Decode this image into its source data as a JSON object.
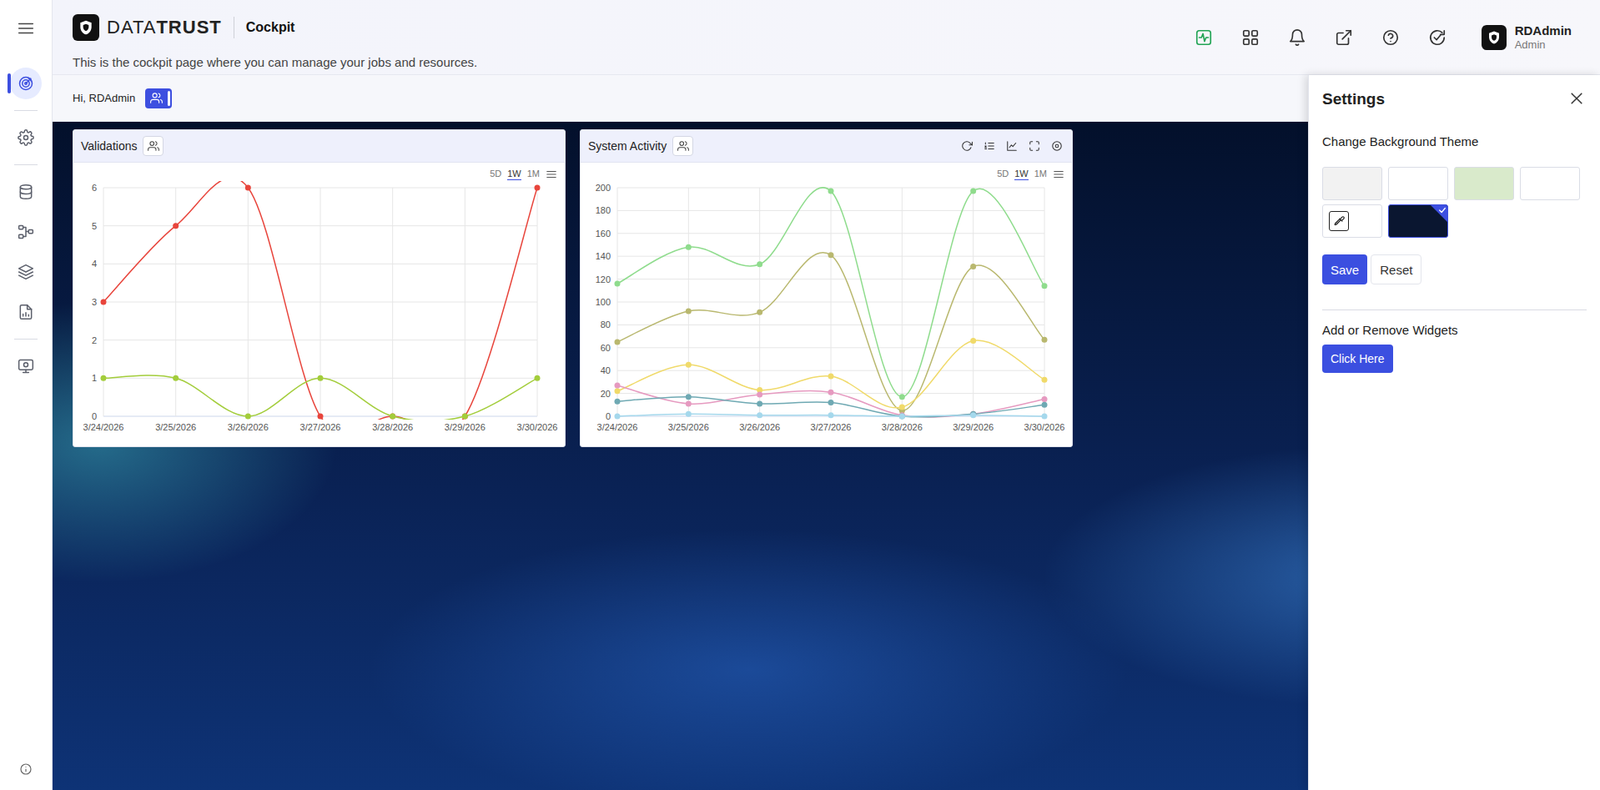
{
  "sidebar": {
    "items": [
      {
        "selected": true
      },
      {
        "selected": false
      },
      {
        "selected": false
      },
      {
        "selected": false
      },
      {
        "selected": false
      },
      {
        "selected": false
      },
      {
        "selected": false
      }
    ]
  },
  "header": {
    "logo": {
      "light": "DATA",
      "bold": "TRUST"
    },
    "page": "Cockpit",
    "subtitle": "This is the cockpit page where you can manage your jobs and resources.",
    "actions": [
      {
        "selected": true
      },
      {
        "selected": false
      },
      {
        "selected": false
      },
      {
        "selected": false
      },
      {
        "selected": false
      },
      {
        "selected": false
      }
    ],
    "user": {
      "name": "RDAdmin",
      "role": "Admin"
    }
  },
  "greeting": {
    "text": "Hi, RDAdmin",
    "team_view": true
  },
  "widgets": [
    {
      "title": "Validations",
      "toolbar": false,
      "ranges": [
        {
          "label": "5D",
          "selected": false
        },
        {
          "label": "1W",
          "selected": true
        },
        {
          "label": "1M",
          "selected": false
        }
      ],
      "y_ticks": [
        "0",
        "1",
        "2",
        "3",
        "4",
        "5",
        "6"
      ],
      "x_labels": [
        "3/24/2026",
        "3/25/2026",
        "3/26/2026",
        "3/27/2026",
        "3/28/2026",
        "3/29/2026",
        "3/30/2026"
      ],
      "series": [
        {
          "color": "#e8453c",
          "values": [
            3,
            5,
            6,
            0,
            0,
            0,
            6
          ]
        },
        {
          "color": "#a3cd3b",
          "values": [
            1,
            1,
            0,
            1,
            0,
            0,
            1
          ]
        }
      ]
    },
    {
      "title": "System Activity",
      "toolbar": true,
      "ranges": [
        {
          "label": "5D",
          "selected": false
        },
        {
          "label": "1W",
          "selected": true
        },
        {
          "label": "1M",
          "selected": false
        }
      ],
      "y_ticks": [
        "0",
        "20",
        "40",
        "60",
        "80",
        "100",
        "120",
        "140",
        "160",
        "180",
        "200"
      ],
      "x_labels": [
        "3/24/2026",
        "3/25/2026",
        "3/26/2026",
        "3/27/2026",
        "3/28/2026",
        "3/29/2026",
        "3/30/2026"
      ],
      "series": [
        {
          "color": "#8fdc8d",
          "values": [
            116,
            148,
            133,
            197,
            17,
            197,
            114
          ]
        },
        {
          "color": "#b9b86f",
          "values": [
            65,
            92,
            91,
            141,
            5,
            131,
            67
          ]
        },
        {
          "color": "#f0da6a",
          "values": [
            22,
            45,
            23,
            35,
            8,
            66,
            32
          ]
        },
        {
          "color": "#e69ac0",
          "values": [
            27,
            11,
            19,
            21,
            1,
            2,
            15
          ]
        },
        {
          "color": "#6fa9b3",
          "values": [
            13,
            17,
            11,
            12,
            0,
            2,
            10
          ]
        },
        {
          "color": "#a5d8ec",
          "values": [
            0,
            2,
            1,
            1,
            0,
            1,
            0
          ]
        }
      ]
    }
  ],
  "settings": {
    "title": "Settings",
    "section": "Change Background Theme",
    "swatches": [
      {
        "kind": "color",
        "color": "#f2f2f2",
        "selected": false
      },
      {
        "kind": "color",
        "color": "#ffffff",
        "selected": false
      },
      {
        "kind": "color",
        "color": "#d9eacb",
        "selected": false
      },
      {
        "kind": "color",
        "color": "#ffffff",
        "selected": false
      },
      {
        "kind": "picker",
        "color": "#ffffff",
        "selected": false
      },
      {
        "kind": "color",
        "color": "#0a1630",
        "selected": true
      }
    ],
    "save": "Save",
    "reset": "Reset",
    "widgets_heading": "Add or Remove Widgets",
    "widgets_button": "Click Here"
  }
}
